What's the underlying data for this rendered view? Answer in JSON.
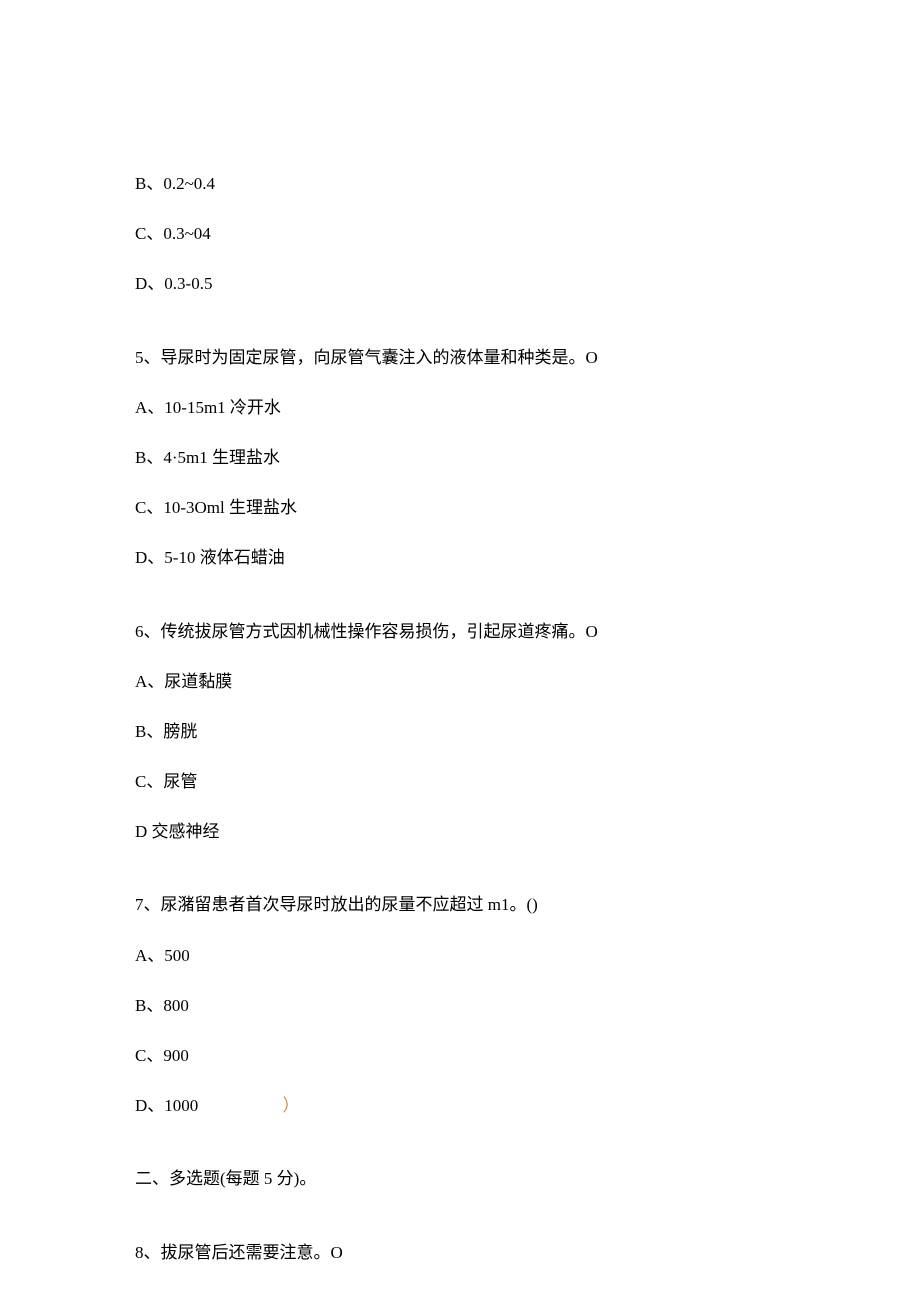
{
  "q4_options": {
    "b": "B、0.2~0.4",
    "c": "C、0.3~04",
    "d": "D、0.3-0.5"
  },
  "q5": {
    "stem": "5、导尿时为固定尿管，向尿管气囊注入的液体量和种类是。O",
    "a": "A、10-15m1 冷开水",
    "b": "B、4·5m1 生理盐水",
    "c": "C、10-3Oml 生理盐水",
    "d": "D、5-10 液体石蜡油"
  },
  "q6": {
    "stem": "6、传统拔尿管方式因机械性操作容易损伤，引起尿道疼痛。O",
    "a": "A、尿道黏膜",
    "b": "B、膀胱",
    "c": "C、尿管",
    "d": "D 交感神经"
  },
  "q7": {
    "stem": "7、尿潴留患者首次导尿时放出的尿量不应超过 m1。()",
    "a": "A、500",
    "b": "B、800",
    "c": "C、900",
    "d": "D、1000",
    "paren": "）"
  },
  "section2": "二、多选题(每题 5 分)。",
  "q8": {
    "stem": "8、拔尿管后还需要注意。O"
  }
}
